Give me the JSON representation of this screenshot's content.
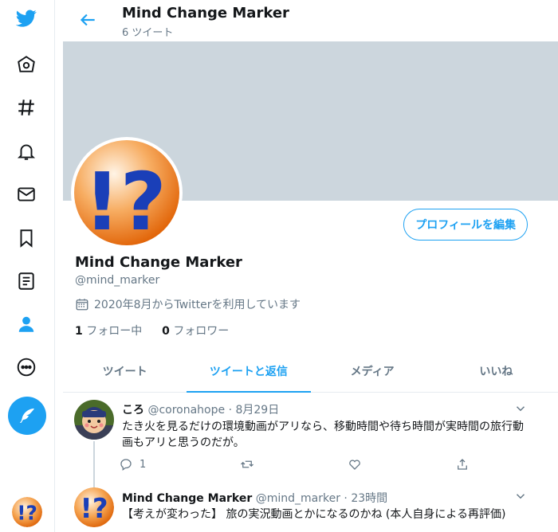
{
  "header": {
    "title": "Mind Change Marker",
    "subtitle": "6 ツイート"
  },
  "profile": {
    "name": "Mind Change Marker",
    "handle": "@mind_marker",
    "joined": "2020年8月からTwitterを利用しています",
    "following_count": "1",
    "following_label": "フォロー中",
    "followers_count": "0",
    "followers_label": "フォロワー",
    "edit_button": "プロフィールを編集",
    "avatar_text": "!?"
  },
  "tabs": [
    {
      "label": "ツイート"
    },
    {
      "label": "ツイートと返信",
      "active": true
    },
    {
      "label": "メディア"
    },
    {
      "label": "いいね"
    }
  ],
  "tweets": [
    {
      "name": "ころ",
      "handle": "@coronahope",
      "time": "8月29日",
      "text": "たき火を見るだけの環境動画がアリなら、移動時間や待ち時間が実時間の旅行動画もアリと思うのだが。",
      "reply_count": "1"
    },
    {
      "name": "Mind Change Marker",
      "handle": "@mind_marker",
      "time": "23時間",
      "text": "【考えが変わった】 旅の実況動画とかになるのかね (本人自身による再評価)"
    }
  ],
  "nav_icons": [
    "twitter-logo-icon",
    "home-icon",
    "explore-hashtag-icon",
    "notifications-bell-icon",
    "messages-mail-icon",
    "bookmarks-icon",
    "lists-icon",
    "profile-person-icon",
    "more-icon"
  ],
  "colors": {
    "accent": "#1da1f2",
    "banner": "#ccd6dd",
    "logo_orange": "#f0802a",
    "logo_blue": "#1a3fb8"
  }
}
